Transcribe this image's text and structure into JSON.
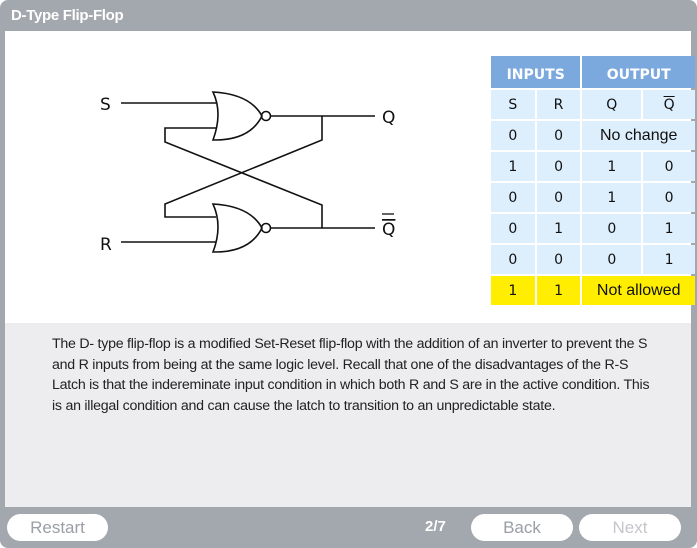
{
  "window": {
    "title": "D-Type Flip-Flop"
  },
  "diagram": {
    "input_s": "S",
    "input_r": "R",
    "output_q": "Q",
    "output_qbar": "Q"
  },
  "truth_table": {
    "group_headers": [
      "INPUTS",
      "OUTPUT"
    ],
    "columns": [
      "S",
      "R",
      "Q",
      "Q"
    ],
    "rows": [
      {
        "s": "0",
        "r": "0",
        "merged": "No change"
      },
      {
        "s": "1",
        "r": "0",
        "q": "1",
        "qbar": "0"
      },
      {
        "s": "0",
        "r": "0",
        "q": "1",
        "qbar": "0"
      },
      {
        "s": "0",
        "r": "1",
        "q": "0",
        "qbar": "1"
      },
      {
        "s": "0",
        "r": "0",
        "q": "0",
        "qbar": "1"
      },
      {
        "s": "1",
        "r": "1",
        "merged": "Not allowed"
      }
    ],
    "highlight_color": "#ffee00",
    "header_color": "#7ba9dd",
    "cell_color": "#ddeefd"
  },
  "description": "The D- type flip-flop is a modified Set-Reset flip-flop with the addition of an inverter to prevent the S and R inputs from being at the same logic level. Recall that one of the disadvantages of the R-S Latch is that the indereminate input condition in which both R and S are in the active condition. This is an illegal condition and can cause the latch to transition to an unpredictable state.",
  "footer": {
    "restart_label": "Restart",
    "page_indicator": "2/7",
    "back_label": "Back",
    "next_label": "Next"
  }
}
